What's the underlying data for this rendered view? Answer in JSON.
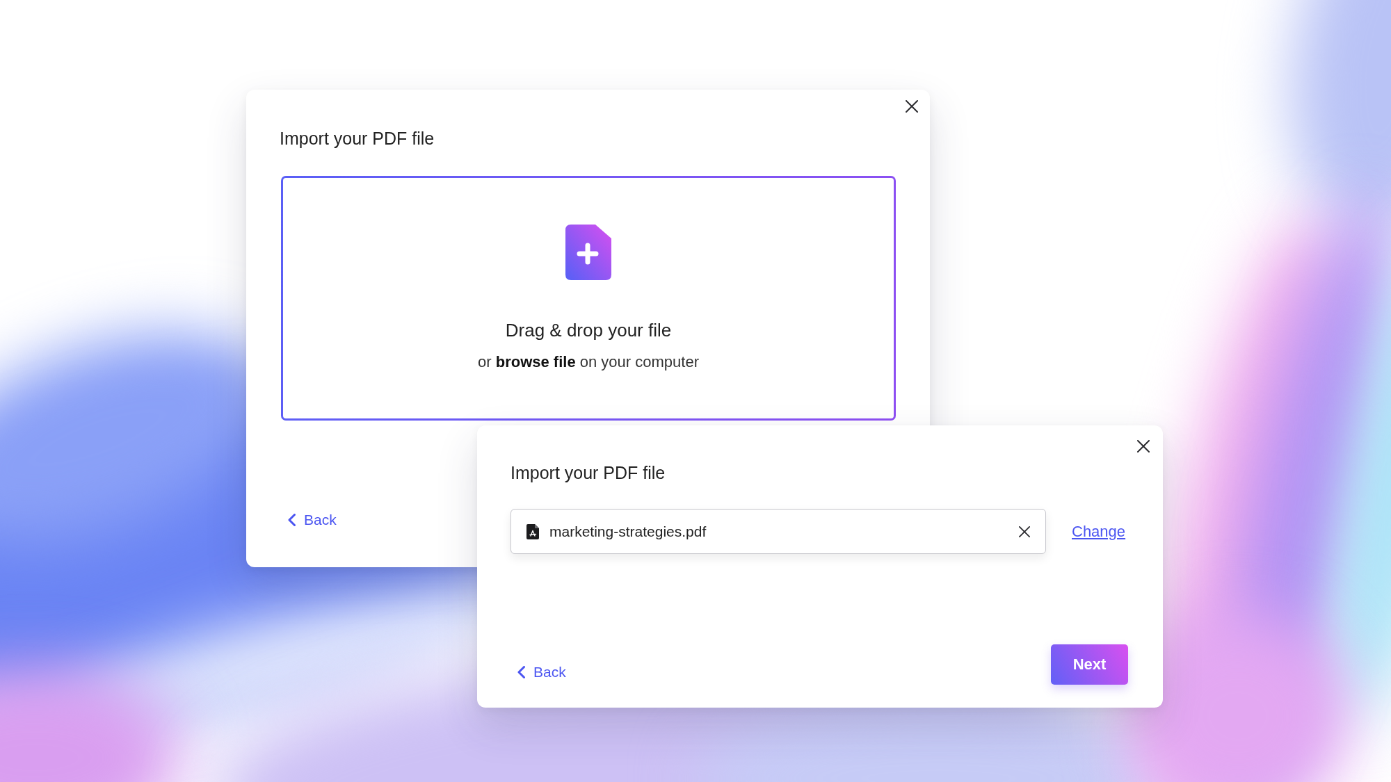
{
  "dialogs": [
    {
      "kind": "dropzone",
      "title": "Import your PDF file",
      "dropzone": {
        "heading": "Drag & drop your file",
        "hint": "or **browse file** on your computer"
      },
      "back": "Back"
    },
    {
      "kind": "selected-file",
      "title": "Import your PDF file",
      "file": {
        "name": "marketing-strategies.pdf"
      },
      "change": "Change",
      "back": "Back",
      "next": "Next"
    }
  ]
}
